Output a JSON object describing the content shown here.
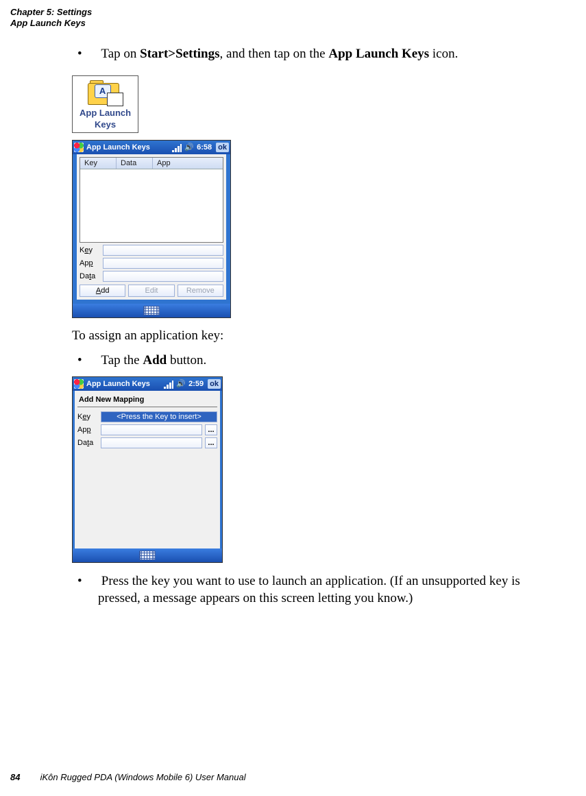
{
  "header": {
    "line1": "Chapter 5: Settings",
    "line2": "App Launch Keys"
  },
  "body": {
    "step1_pre": "Tap on ",
    "step1_bold1": "Start>Settings",
    "step1_mid": ", and then tap on the ",
    "step1_bold2": "App Launch Keys",
    "step1_post": " icon.",
    "assign_intro": "To assign an application key:",
    "step2_pre": "Tap the ",
    "step2_bold": "Add",
    "step2_post": " button.",
    "step3": "Press the key you want to use to launch an application. (If an unsupported key is pressed, a message appears on this screen letting you know.)"
  },
  "icon_fig": {
    "letter": "A",
    "label1": "App Launch",
    "label2": "Keys"
  },
  "wm1": {
    "title": "App Launch Keys",
    "clock": "6:58",
    "ok": "ok",
    "columns": {
      "c1": "Key",
      "c2": "Data",
      "c3": "App"
    },
    "labels": {
      "key_pre": "K",
      "key_u": "e",
      "key_post": "y",
      "app_pre": "Ap",
      "app_u": "p",
      "app_post": "",
      "data_pre": "Da",
      "data_u": "t",
      "data_post": "a"
    },
    "buttons": {
      "add_u": "A",
      "add_post": "dd",
      "edit": "Edit",
      "remove": "Remove"
    }
  },
  "wm2": {
    "title": "App Launch Keys",
    "clock": "2:59",
    "ok": "ok",
    "section": "Add New Mapping",
    "labels": {
      "key_pre": "K",
      "key_u": "e",
      "key_post": "y",
      "app_pre": "Ap",
      "app_u": "p",
      "app_post": "",
      "data_pre": "Da",
      "data_u": "t",
      "data_post": "a"
    },
    "key_placeholder": "<Press the Key to insert>",
    "browse": "..."
  },
  "footer": {
    "page": "84",
    "title": "iKôn Rugged PDA (Windows Mobile 6) User Manual"
  }
}
